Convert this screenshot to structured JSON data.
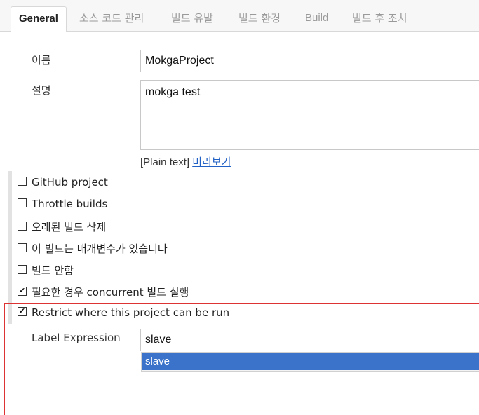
{
  "tabs": {
    "general": "General",
    "scm": "소스 코드 관리",
    "triggers": "빌드 유발",
    "environment": "빌드 환경",
    "build": "Build",
    "post_build": "빌드 후 조치"
  },
  "form": {
    "name_label": "이름",
    "name_value": "MokgaProject",
    "description_label": "설명",
    "description_value": "mokga test",
    "plain_text": "[Plain text]",
    "preview_link": "미리보기"
  },
  "options": [
    {
      "label": "GitHub project",
      "checked": false
    },
    {
      "label": "Throttle builds",
      "checked": false
    },
    {
      "label": "오래된 빌드 삭제",
      "checked": false
    },
    {
      "label": "이 빌드는 매개변수가 있습니다",
      "checked": false
    },
    {
      "label": "빌드 안함",
      "checked": false
    },
    {
      "label": "필요한 경우 concurrent 빌드 실행",
      "checked": true
    },
    {
      "label": "Restrict where this project can be run",
      "checked": true
    }
  ],
  "restrict": {
    "label_expression_label": "Label Expression",
    "label_expression_value": "slave",
    "suggestion": "slave"
  },
  "colors": {
    "accent_red": "#dd3333",
    "selection_blue": "#3a73c9",
    "link_blue": "#2160c4"
  }
}
